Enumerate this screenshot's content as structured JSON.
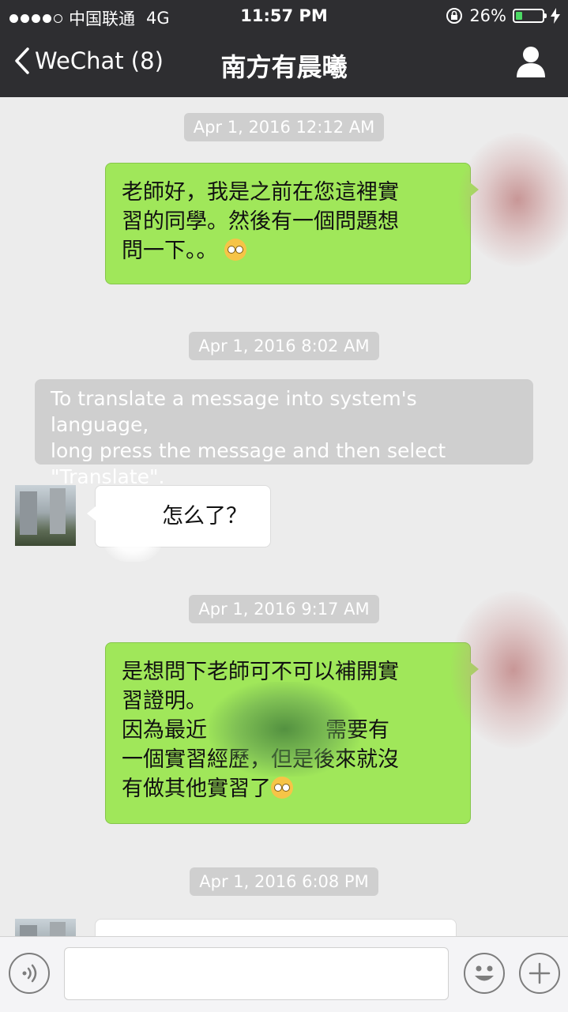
{
  "status_bar": {
    "carrier": "中国联通",
    "network": "4G",
    "time": "11:57 PM",
    "battery": "26%",
    "battery_level": 0.26
  },
  "nav": {
    "back_label": "WeChat (8)",
    "title": "南方有晨曦"
  },
  "messages": [
    {
      "type": "timestamp",
      "text": "Apr 1, 2016 12:12 AM"
    },
    {
      "type": "outgoing",
      "lines": [
        "老師好，我是之前在您這裡實",
        "習的同學。然後有一個問題想",
        "問一下。。"
      ]
    },
    {
      "type": "timestamp",
      "text": "Apr 1, 2016 8:02 AM"
    },
    {
      "type": "system",
      "lines": [
        "To translate a message into system's language,",
        "long press the message and then select",
        "\"Translate\"."
      ]
    },
    {
      "type": "incoming",
      "text": "怎么了？"
    },
    {
      "type": "timestamp",
      "text": "Apr 1, 2016 9:17 AM"
    },
    {
      "type": "outgoing",
      "lines": [
        "是想問下老師可不可以補開實",
        "習證明。",
        "因為最近",
        "需要有",
        "一個實習經歷，但是後來就沒",
        "有做其他實習了"
      ]
    },
    {
      "type": "timestamp",
      "text": "Apr 1, 2016 6:08 PM"
    }
  ],
  "input": {
    "value": "",
    "placeholder": ""
  },
  "icons": {
    "back": "chevron-left-icon",
    "profile": "person-icon",
    "voice": "voice-icon",
    "emoji": "smiley-icon",
    "add": "plus-icon",
    "emoji_inline": "flushed-face-icon"
  },
  "colors": {
    "header": "#2e2e31",
    "chat_bg": "#ececec",
    "outgoing_bubble": "#a0e75a",
    "incoming_bubble": "#ffffff",
    "timestamp_bg": "#cfcfcf",
    "battery_fill": "#4cd964"
  }
}
